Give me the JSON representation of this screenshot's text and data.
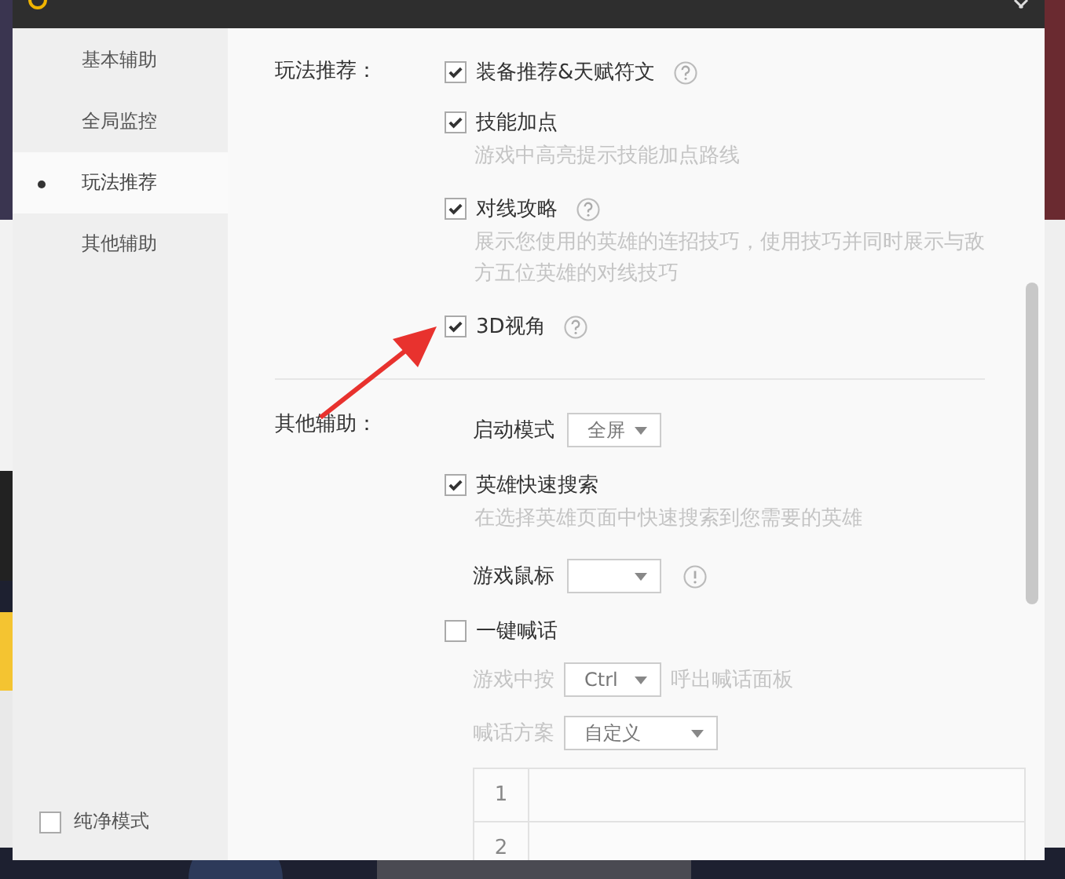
{
  "sidebar": {
    "items": [
      {
        "label": "基本辅助",
        "selected": false
      },
      {
        "label": "全局监控",
        "selected": false
      },
      {
        "label": "玩法推荐",
        "selected": true
      },
      {
        "label": "其他辅助",
        "selected": false
      }
    ],
    "pure_mode": {
      "label": "纯净模式",
      "checked": false
    }
  },
  "sections": [
    {
      "label": "玩法推荐：",
      "items": [
        {
          "kind": "check",
          "label": "装备推荐&天赋符文",
          "checked": true,
          "help": true
        },
        {
          "kind": "check",
          "label": "技能加点",
          "checked": true,
          "description": "游戏中高亮提示技能加点路线"
        },
        {
          "kind": "check",
          "label": "对线攻略",
          "checked": true,
          "help": true,
          "description": "展示您使用的英雄的连招技巧，使用技巧并同时展示与敌方五位英雄的对线技巧"
        },
        {
          "kind": "check",
          "label": "3D视角",
          "checked": true,
          "help": true
        }
      ]
    },
    {
      "label": "其他辅助：",
      "items": [
        {
          "kind": "select",
          "label": "启动模式",
          "value": "全屏"
        },
        {
          "kind": "check",
          "label": "英雄快速搜索",
          "checked": true,
          "description": "在选择英雄页面中快速搜索到您需要的英雄"
        },
        {
          "kind": "select",
          "label": "游戏鼠标",
          "info": true
        },
        {
          "kind": "check",
          "label": "一键喊话",
          "checked": false,
          "sub": [
            {
              "kind": "hotkey",
              "label": "游戏中按",
              "value": "Ctrl",
              "suffix": "呼出喊话面板"
            },
            {
              "kind": "select",
              "label": "喊话方案",
              "value": "自定义"
            }
          ],
          "table_rows": [
            "1",
            "2"
          ]
        }
      ]
    }
  ]
}
